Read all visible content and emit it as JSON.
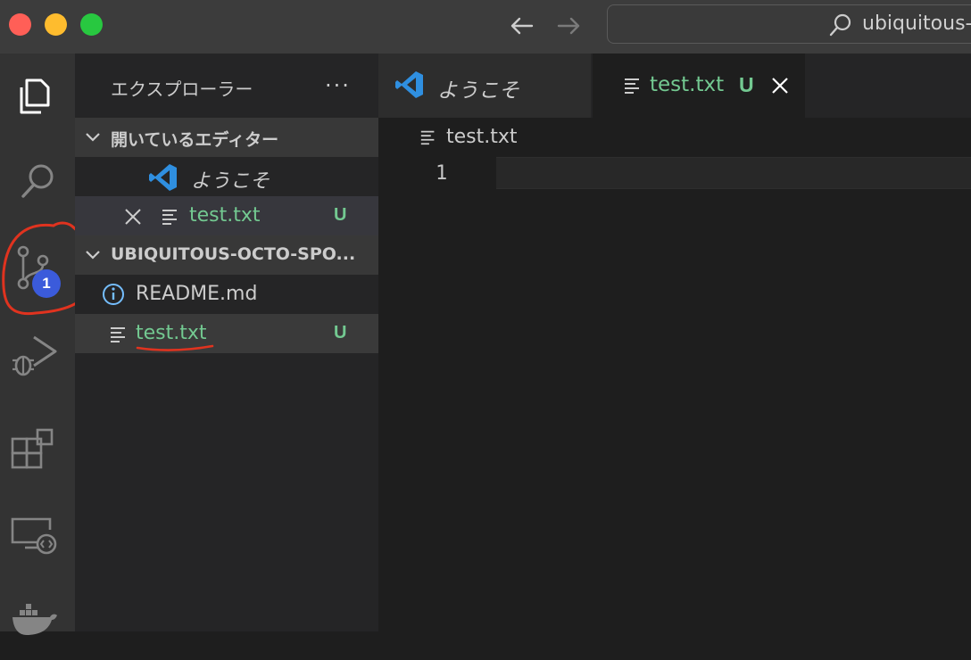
{
  "titlebar": {
    "search_text": "ubiquitous-"
  },
  "activitybar": {
    "icons": [
      "explorer-icon",
      "search-icon",
      "source-control-icon",
      "run-debug-icon",
      "extensions-icon",
      "remote-explorer-icon",
      "docker-icon"
    ],
    "source_control_badge": "1"
  },
  "sidebar": {
    "title": "エクスプローラー",
    "open_editors": {
      "header": "開いているエディター",
      "items": [
        {
          "label": "ようこそ",
          "icon": "vscode-icon"
        },
        {
          "label": "test.txt",
          "status": "U",
          "icon": "file-lines-icon"
        }
      ]
    },
    "workspace": {
      "header": "UBIQUITOUS-OCTO-SPO...",
      "items": [
        {
          "label": "README.md",
          "icon": "info-icon"
        },
        {
          "label": "test.txt",
          "status": "U",
          "icon": "file-lines-icon"
        }
      ]
    }
  },
  "editor": {
    "tabs": [
      {
        "label": "ようこそ",
        "active": false
      },
      {
        "label": "test.txt",
        "status": "U",
        "active": true
      }
    ],
    "breadcrumb": "test.txt",
    "line_number": "1"
  },
  "colors": {
    "untracked_green": "#73c991",
    "badge_blue": "#3b5bdb",
    "annotation_red": "#e0331f",
    "vscode_blue": "#2f8fe0"
  }
}
